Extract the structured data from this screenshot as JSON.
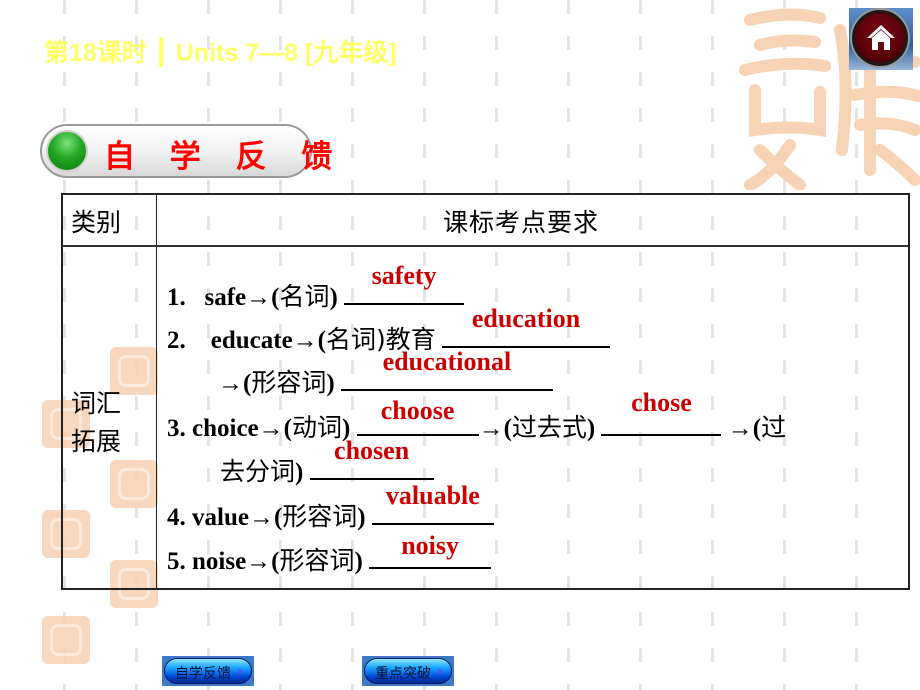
{
  "header": {
    "title": "第18课时 ┃ Units 7—8 [九年级]",
    "home_icon": "home-icon"
  },
  "section": {
    "label": "自 学 反 馈",
    "indicator_color": "#22a822",
    "label_color": "#ff0000"
  },
  "table": {
    "headers": [
      "类别",
      "课标考点要求"
    ],
    "category": [
      "词汇",
      "拓展"
    ],
    "items": [
      {
        "num": "1.",
        "prefix": "safe→(",
        "cn": "名词",
        "suffix": ")",
        "answer": "safety"
      },
      {
        "num": "2.",
        "prefix": "educate→(",
        "cn": "名词)教育",
        "suffix": "",
        "answer": "education"
      },
      {
        "num": "",
        "prefix": "→(",
        "cn": "形容词",
        "suffix": ")",
        "answer": "educational"
      },
      {
        "num": "3.",
        "prefix": "choice→(",
        "cn": "动词",
        "suffix": ")",
        "answer": "choose",
        "mid": "→(",
        "mid_cn": "过去式",
        "mid_suffix": ")",
        "answer2": "chose",
        "tail": "→(",
        "tail_cn": "过"
      },
      {
        "num": "",
        "prefix": "",
        "cn": "去分词",
        "suffix": ")",
        "answer": "chosen"
      },
      {
        "num": "4.",
        "prefix": "value→(",
        "cn": "形容词",
        "suffix": ")",
        "answer": "valuable"
      },
      {
        "num": "5.",
        "prefix": "noise→(",
        "cn": "形容词",
        "suffix": ")",
        "answer": "noisy"
      }
    ],
    "answer_color": "#cc0000"
  },
  "nav": {
    "buttons": [
      {
        "label": "自学反馈",
        "arrow": "›"
      },
      {
        "label": "重点突破",
        "arrow": "›"
      }
    ]
  },
  "colors": {
    "title": "#ffff66",
    "home_bg": "#5a0008",
    "nav_button": "#1aa8ff"
  }
}
